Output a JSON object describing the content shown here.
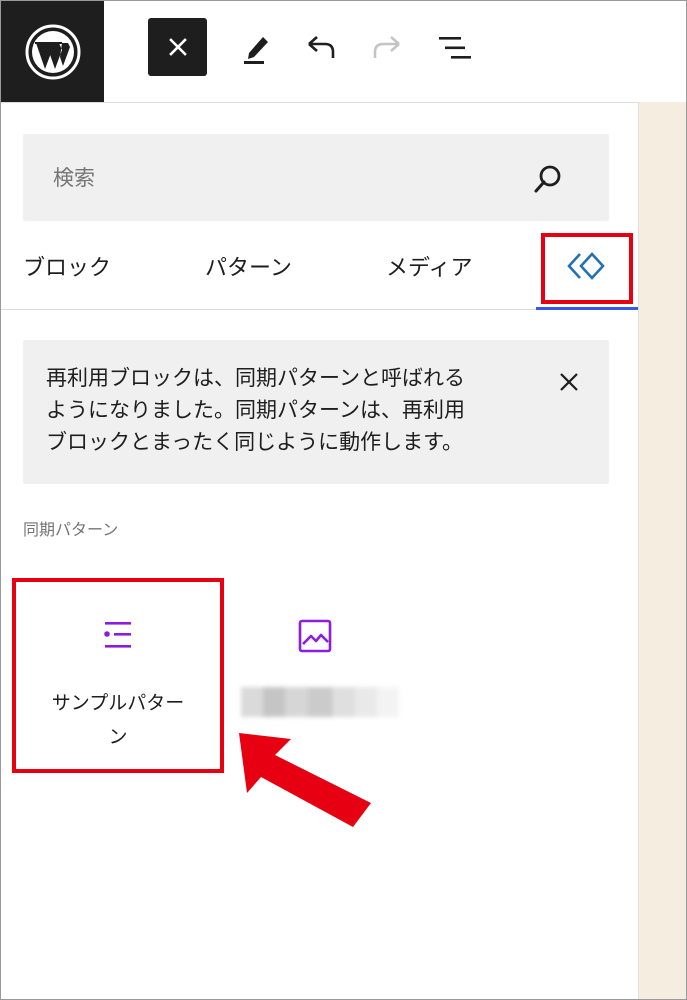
{
  "toolbar": {
    "logo_icon": "wordpress-logo-icon",
    "close_icon": "close-icon",
    "tools_icon": "pencil-icon",
    "undo_icon": "undo-icon",
    "redo_icon": "redo-icon",
    "list_view_icon": "list-view-icon"
  },
  "search": {
    "placeholder": "検索",
    "icon": "search-icon"
  },
  "tabs": [
    {
      "label": "ブロック"
    },
    {
      "label": "パターン"
    },
    {
      "label": "メディア"
    },
    {
      "label": "",
      "icon": "synced-pattern-icon",
      "selected": true
    }
  ],
  "notice": {
    "lines": [
      "再利用ブロックは、同期パターンと呼ばれる",
      "ようになりました。同期パターンは、再利用",
      "ブロックとまったく同じように動作します。"
    ],
    "close_icon": "close-icon"
  },
  "section": {
    "title": "同期パターン"
  },
  "patterns": [
    {
      "icon": "list-icon",
      "label": "サンプルパター\nン"
    },
    {
      "icon": "image-icon",
      "label": ""
    }
  ],
  "colors": {
    "accent": "#3858e9",
    "pattern_icon": "#8c1de0",
    "highlight": "#e60012",
    "toolbar_dark": "#1e1e1e",
    "panel_bg": "#f0f0f0",
    "canvas_bg": "#f4ede0"
  }
}
